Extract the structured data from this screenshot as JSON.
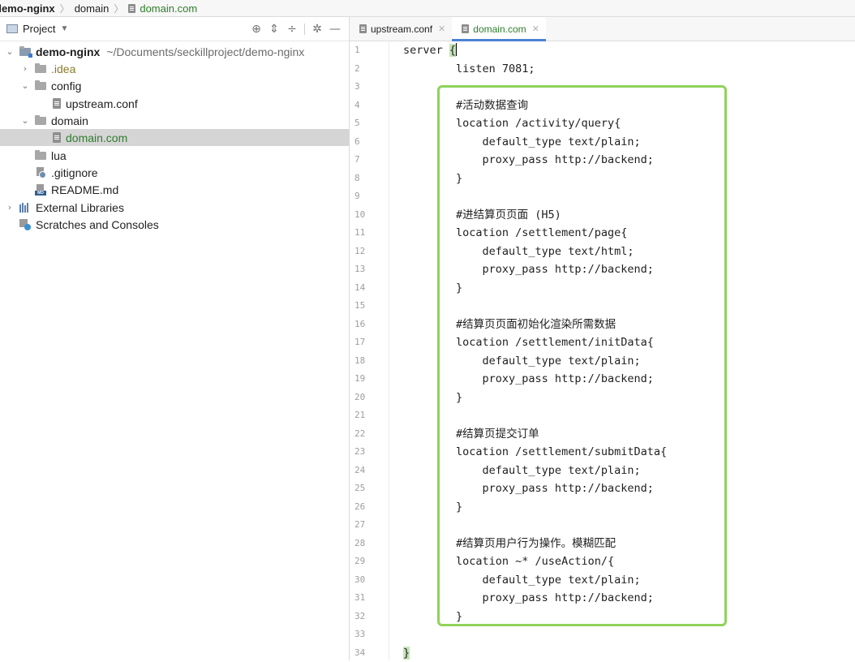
{
  "breadcrumb": {
    "items": [
      "demo-nginx",
      "domain",
      "domain.com"
    ]
  },
  "project_panel": {
    "title": "Project",
    "toolbar_icons": [
      "locate-icon",
      "expand-all-icon",
      "collapse-all-icon",
      "gear-icon",
      "minimize-icon"
    ],
    "tree": [
      {
        "label": "demo-nginx",
        "path": "~/Documents/seckillproject/demo-nginx",
        "type": "module",
        "expanded": true
      },
      {
        "label": ".idea",
        "type": "folder",
        "expanded": false
      },
      {
        "label": "config",
        "type": "folder",
        "expanded": true
      },
      {
        "label": "upstream.conf",
        "type": "file"
      },
      {
        "label": "domain",
        "type": "folder",
        "expanded": true
      },
      {
        "label": "domain.com",
        "type": "file",
        "selected": true
      },
      {
        "label": "lua",
        "type": "folder"
      },
      {
        "label": ".gitignore",
        "type": "gitignore"
      },
      {
        "label": "README.md",
        "type": "markdown"
      },
      {
        "label": "External Libraries",
        "type": "libraries",
        "expanded": false
      },
      {
        "label": "Scratches and Consoles",
        "type": "scratches"
      }
    ]
  },
  "tabs": [
    {
      "label": "upstream.conf",
      "active": false
    },
    {
      "label": "domain.com",
      "active": true
    }
  ],
  "editor": {
    "lines": [
      "server {",
      "        listen 7081;",
      "",
      "        #活动数据查询",
      "        location /activity/query{",
      "            default_type text/plain;",
      "            proxy_pass http://backend;",
      "        }",
      "",
      "        #进结算页页面 (H5)",
      "        location /settlement/page{",
      "            default_type text/html;",
      "            proxy_pass http://backend;",
      "        }",
      "",
      "        #结算页页面初始化渲染所需数据",
      "        location /settlement/initData{",
      "            default_type text/plain;",
      "            proxy_pass http://backend;",
      "        }",
      "",
      "        #结算页提交订单",
      "        location /settlement/submitData{",
      "            default_type text/plain;",
      "            proxy_pass http://backend;",
      "        }",
      "",
      "        #结算页用户行为操作。模糊匹配",
      "        location ~* /useAction/{",
      "            default_type text/plain;",
      "            proxy_pass http://backend;",
      "        }",
      "",
      "}"
    ],
    "highlight_color": "#8fd35a",
    "brace_highlight_color": "#c6e3b8"
  }
}
